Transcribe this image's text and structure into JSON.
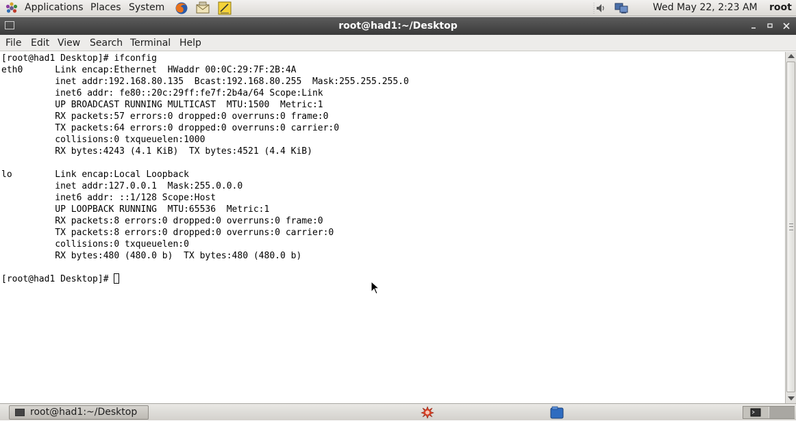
{
  "top_panel": {
    "menus": [
      "Applications",
      "Places",
      "System"
    ],
    "launchers": [
      "firefox-icon",
      "email-client-icon",
      "text-editor-icon"
    ],
    "tray": [
      "volume-icon",
      "network-icon"
    ],
    "clock": "Wed May 22,  2:23 AM",
    "user": "root"
  },
  "window": {
    "title": "root@had1:~/Desktop",
    "controls": [
      "minimize",
      "maximize",
      "close"
    ]
  },
  "menu_bar": [
    "File",
    "Edit",
    "View",
    "Search",
    "Terminal",
    "Help"
  ],
  "terminal": {
    "lines": [
      "[root@had1 Desktop]# ifconfig",
      "eth0      Link encap:Ethernet  HWaddr 00:0C:29:7F:2B:4A  ",
      "          inet addr:192.168.80.135  Bcast:192.168.80.255  Mask:255.255.255.0",
      "          inet6 addr: fe80::20c:29ff:fe7f:2b4a/64 Scope:Link",
      "          UP BROADCAST RUNNING MULTICAST  MTU:1500  Metric:1",
      "          RX packets:57 errors:0 dropped:0 overruns:0 frame:0",
      "          TX packets:64 errors:0 dropped:0 overruns:0 carrier:0",
      "          collisions:0 txqueuelen:1000 ",
      "          RX bytes:4243 (4.1 KiB)  TX bytes:4521 (4.4 KiB)",
      "",
      "lo        Link encap:Local Loopback  ",
      "          inet addr:127.0.0.1  Mask:255.0.0.0",
      "          inet6 addr: ::1/128 Scope:Host",
      "          UP LOOPBACK RUNNING  MTU:65536  Metric:1",
      "          RX packets:8 errors:0 dropped:0 overruns:0 frame:0",
      "          TX packets:8 errors:0 dropped:0 overruns:0 carrier:0",
      "          collisions:0 txqueuelen:0 ",
      "          RX bytes:480 (480.0 b)  TX bytes:480 (480.0 b)",
      ""
    ],
    "prompt": "[root@had1 Desktop]# "
  },
  "bottom_panel": {
    "task_label": "root@had1:~/Desktop"
  }
}
